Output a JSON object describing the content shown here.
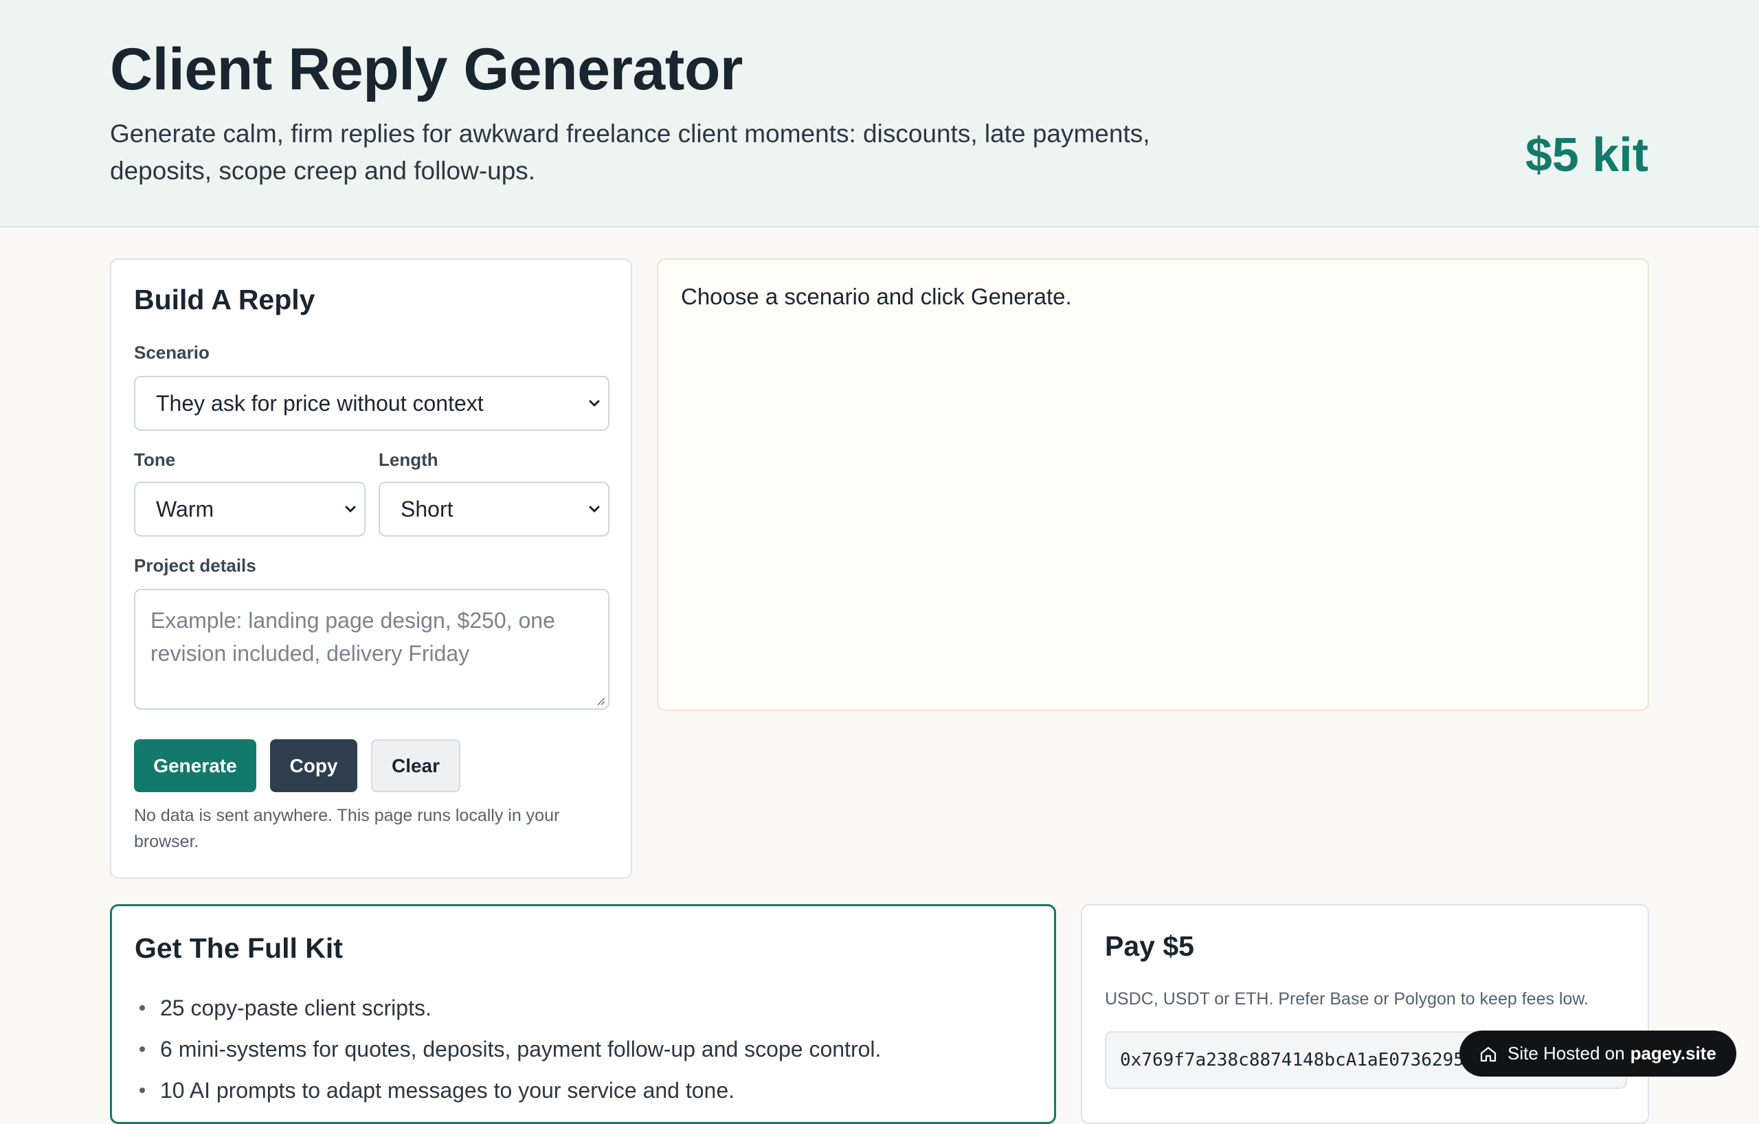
{
  "header": {
    "title": "Client Reply Generator",
    "subtitle": "Generate calm, firm replies for awkward freelance client moments: discounts, late payments, deposits, scope creep and follow-ups.",
    "price": "$5 kit"
  },
  "builder": {
    "heading": "Build A Reply",
    "scenario_label": "Scenario",
    "scenario_value": "They ask for price without context",
    "tone_label": "Tone",
    "tone_value": "Warm",
    "length_label": "Length",
    "length_value": "Short",
    "details_label": "Project details",
    "details_placeholder": "Example: landing page design, $250, one revision included, delivery Friday",
    "generate_label": "Generate",
    "copy_label": "Copy",
    "clear_label": "Clear",
    "privacy_note": "No data is sent anywhere. This page runs locally in your browser."
  },
  "output": {
    "text": "Choose a scenario and click Generate."
  },
  "kit": {
    "heading": "Get The Full Kit",
    "items": [
      "25 copy-paste client scripts.",
      "6 mini-systems for quotes, deposits, payment follow-up and scope control.",
      "10 AI prompts to adapt messages to your service and tone."
    ]
  },
  "pay": {
    "heading": "Pay $5",
    "subtext": "USDC, USDT or ETH. Prefer Base or Polygon to keep fees low.",
    "wallet": "0x769f7a238c8874148bcA1aE0736295"
  },
  "badge": {
    "prefix": "Site Hosted on",
    "brand": "pagey.site"
  },
  "colors": {
    "accent": "#137a6b",
    "dark_button": "#2f3e4d",
    "hero_bg": "#edf5f2"
  }
}
